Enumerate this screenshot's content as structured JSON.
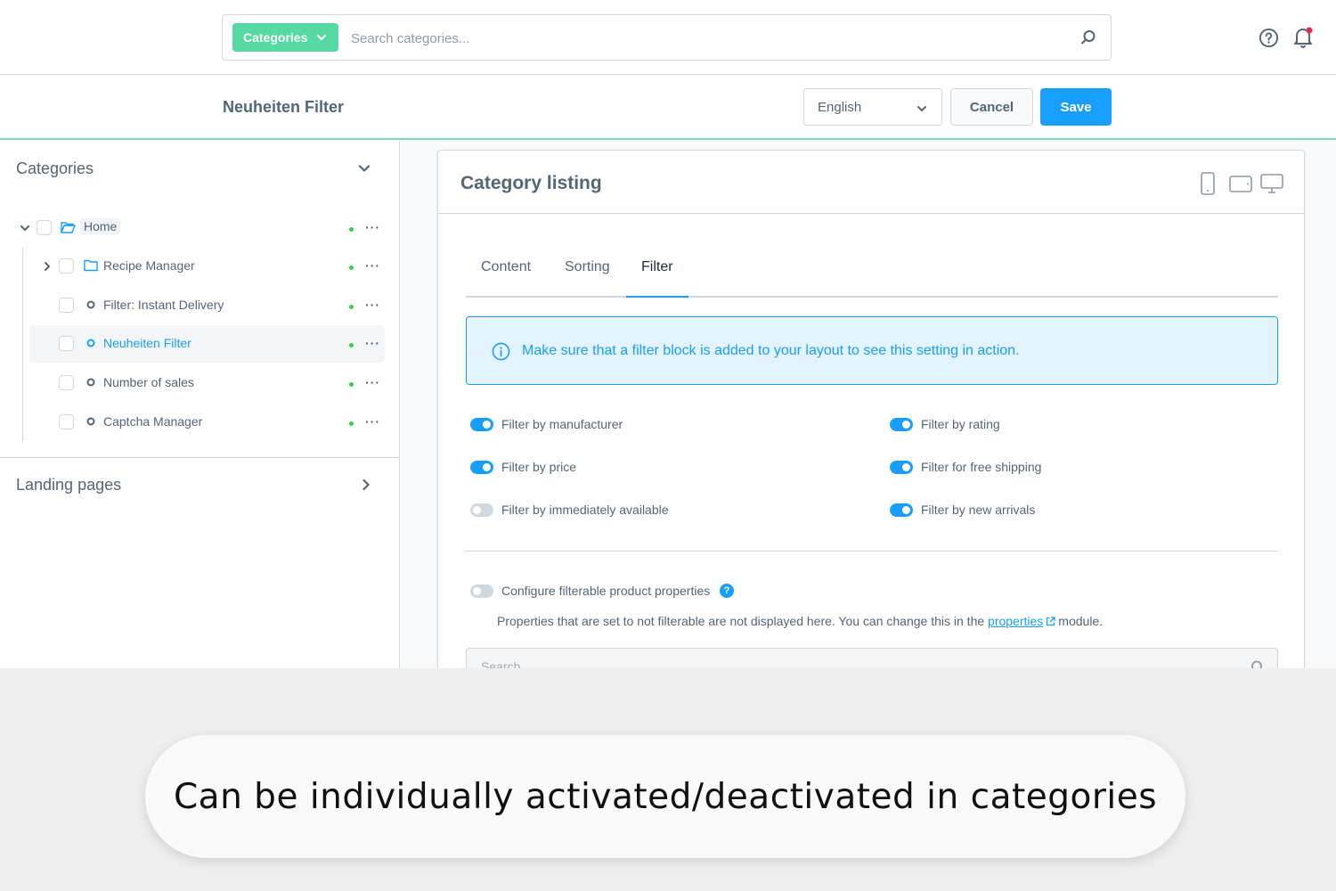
{
  "topbar": {
    "category_button_label": "Categories",
    "search_placeholder": "Search categories..."
  },
  "header": {
    "title": "Neuheiten Filter",
    "language": "English",
    "cancel_label": "Cancel",
    "save_label": "Save"
  },
  "sidebar": {
    "heading": "Categories",
    "tree": [
      {
        "label": "Home",
        "type": "folder-open",
        "expanded": true,
        "active": false
      },
      {
        "label": "Recipe Manager",
        "type": "folder",
        "expanded": false,
        "active": false
      },
      {
        "label": "Filter: Instant Delivery",
        "type": "leaf",
        "active": false
      },
      {
        "label": "Neuheiten Filter",
        "type": "leaf",
        "active": true
      },
      {
        "label": "Number of sales",
        "type": "leaf",
        "active": false
      },
      {
        "label": "Captcha Manager",
        "type": "leaf",
        "active": false
      }
    ],
    "more_label": "···",
    "landing_pages_label": "Landing pages"
  },
  "card": {
    "title": "Category listing",
    "tabs": [
      {
        "label": "Content",
        "active": false
      },
      {
        "label": "Sorting",
        "active": false
      },
      {
        "label": "Filter",
        "active": true
      }
    ],
    "alert_text": "Make sure that a filter block is added to your layout to see this setting in action.",
    "filters": [
      {
        "label": "Filter by manufacturer",
        "on": true
      },
      {
        "label": "Filter by price",
        "on": true
      },
      {
        "label": "Filter by immediately available",
        "on": false
      },
      {
        "label": "Filter by rating",
        "on": true
      },
      {
        "label": "Filter for free shipping",
        "on": true
      },
      {
        "label": "Filter by new arrivals",
        "on": true
      }
    ],
    "configure_label": "Configure filterable product properties",
    "configure_on": false,
    "help_mark": "?",
    "properties_text_before": "Properties that are set to not filterable are not displayed here. You can change this in the",
    "properties_link": "properties",
    "properties_text_after": "module.",
    "property_search_placeholder": "Search..."
  },
  "caption": "Can be individually activated/deactivated in categories",
  "colors": {
    "accent": "#189eff",
    "category_button": "#57d9a3",
    "status_active": "#37d046",
    "header_border": "#7bdcb5"
  }
}
